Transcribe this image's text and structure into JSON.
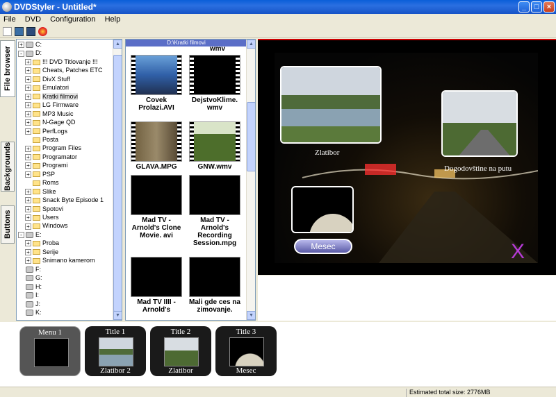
{
  "window": {
    "title": "DVDStyler - Untitled*"
  },
  "menu": [
    "File",
    "DVD",
    "Configuration",
    "Help"
  ],
  "toolbar": [
    "new-file-icon",
    "open-icon",
    "save-icon",
    "burn-icon"
  ],
  "side_tabs": [
    {
      "label": "File browser",
      "active": true
    },
    {
      "label": "Backgrounds",
      "active": false
    },
    {
      "label": "Buttons",
      "active": false
    }
  ],
  "tree": [
    {
      "label": "C:",
      "type": "drive",
      "level": 0,
      "expander": "+"
    },
    {
      "label": "D:",
      "type": "drive",
      "level": 0,
      "expander": "-"
    },
    {
      "label": "!!! DVD Titlovanje !!!",
      "type": "folder",
      "level": 1,
      "expander": "+"
    },
    {
      "label": "Cheats, Patches ETC",
      "type": "folder",
      "level": 1,
      "expander": "+"
    },
    {
      "label": "DivX Stuff",
      "type": "folder",
      "level": 1,
      "expander": "+"
    },
    {
      "label": "Emulatori",
      "type": "folder",
      "level": 1,
      "expander": "+"
    },
    {
      "label": "Kratki filmovi",
      "type": "folder",
      "level": 1,
      "expander": "+",
      "selected": true
    },
    {
      "label": "LG Firmware",
      "type": "folder",
      "level": 1,
      "expander": "+"
    },
    {
      "label": "MP3 Music",
      "type": "folder",
      "level": 1,
      "expander": "+"
    },
    {
      "label": "N-Gage QD",
      "type": "folder",
      "level": 1,
      "expander": "+"
    },
    {
      "label": "PerfLogs",
      "type": "folder",
      "level": 1,
      "expander": "+"
    },
    {
      "label": "Posta",
      "type": "folder",
      "level": 1,
      "expander": ""
    },
    {
      "label": "Program Files",
      "type": "folder",
      "level": 1,
      "expander": "+"
    },
    {
      "label": "Programator",
      "type": "folder",
      "level": 1,
      "expander": "+"
    },
    {
      "label": "Programi",
      "type": "folder",
      "level": 1,
      "expander": "+"
    },
    {
      "label": "PSP",
      "type": "folder",
      "level": 1,
      "expander": "+"
    },
    {
      "label": "Roms",
      "type": "folder",
      "level": 1,
      "expander": ""
    },
    {
      "label": "Slike",
      "type": "folder",
      "level": 1,
      "expander": "+"
    },
    {
      "label": "Snack Byte Episode 1",
      "type": "folder",
      "level": 1,
      "expander": "+"
    },
    {
      "label": "Spotovi",
      "type": "folder",
      "level": 1,
      "expander": "+"
    },
    {
      "label": "Users",
      "type": "folder",
      "level": 1,
      "expander": "+"
    },
    {
      "label": "Windows",
      "type": "folder",
      "level": 1,
      "expander": "+"
    },
    {
      "label": "E:",
      "type": "drive",
      "level": 0,
      "expander": "-"
    },
    {
      "label": "Proba",
      "type": "folder",
      "level": 1,
      "expander": "+"
    },
    {
      "label": "Serije",
      "type": "folder",
      "level": 1,
      "expander": "+"
    },
    {
      "label": "Snimano kamerom",
      "type": "folder",
      "level": 1,
      "expander": "+"
    },
    {
      "label": "F:",
      "type": "drive",
      "level": 0,
      "expander": ""
    },
    {
      "label": "G:",
      "type": "drive",
      "level": 0,
      "expander": ""
    },
    {
      "label": "H:",
      "type": "drive",
      "level": 0,
      "expander": ""
    },
    {
      "label": "I:",
      "type": "drive",
      "level": 0,
      "expander": ""
    },
    {
      "label": "J:",
      "type": "drive",
      "level": 0,
      "expander": ""
    },
    {
      "label": "K:",
      "type": "drive",
      "level": 0,
      "expander": ""
    }
  ],
  "files": {
    "path": "D:\\Kratki filmovi",
    "top_partial": "wmv",
    "items": [
      {
        "name": "Covek Prolazi.AVI",
        "thumb": "portrait",
        "film": true
      },
      {
        "name": "DejstvoKlime. wmv",
        "thumb": "black",
        "film": true
      },
      {
        "name": "GLAVA.MPG",
        "thumb": "room",
        "film": true
      },
      {
        "name": "GNW.wmv",
        "thumb": "field",
        "film": true
      },
      {
        "name": "Mad TV - Arnold's Clone Movie. avi",
        "thumb": "black",
        "film": false
      },
      {
        "name": "Mad TV - Arnold's Recording Session.mpg",
        "thumb": "black",
        "film": false
      },
      {
        "name": "Mad TV IIII - Arnold's",
        "thumb": "black",
        "film": false
      },
      {
        "name": "Mali gde ces na zimovanje.",
        "thumb": "black",
        "film": false
      }
    ]
  },
  "menu_preview": {
    "buttons": [
      {
        "label": "Zlatibor",
        "image": "lake-icon"
      },
      {
        "label": "Dogodovštine na putu",
        "image": "road-icon"
      },
      {
        "label": "Mesec",
        "image": "moon-icon"
      }
    ],
    "nav_label": "Mesec",
    "close_symbol": "X"
  },
  "titleset": [
    {
      "top": "Menu 1",
      "bottom": "",
      "thumb": "menu",
      "selected": true
    },
    {
      "top": "Title 1",
      "bottom": "Zlatibor 2",
      "thumb": "lake",
      "selected": false
    },
    {
      "top": "Title 2",
      "bottom": "Zlatibor",
      "thumb": "road",
      "selected": false
    },
    {
      "top": "Title 3",
      "bottom": "Mesec",
      "thumb": "moon",
      "selected": false
    }
  ],
  "status": {
    "text": "Estimated total size: 2776MB"
  },
  "colors": {
    "titlebar": "#1553c7",
    "preview_border": "#cc0000",
    "close_x": "#b53bd5"
  }
}
